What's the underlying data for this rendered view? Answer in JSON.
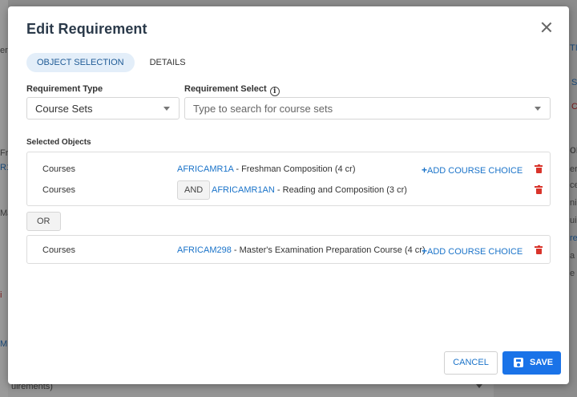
{
  "background": {
    "fragments": [
      "er",
      "Fr",
      "R1",
      "Ma",
      "i",
      "M",
      "TI",
      "S",
      "C",
      "or",
      "er",
      "ce",
      "ni",
      "ui",
      "re",
      "a",
      "e"
    ],
    "bottom_text": "uirements)"
  },
  "modal": {
    "title": "Edit Requirement",
    "tabs": [
      {
        "label": "OBJECT SELECTION",
        "active": true
      },
      {
        "label": "DETAILS",
        "active": false
      }
    ],
    "requirement_type": {
      "label": "Requirement Type",
      "value": "Course Sets"
    },
    "requirement_select": {
      "label": "Requirement Select",
      "placeholder": "Type to search for course sets"
    },
    "selected_objects_label": "Selected Objects",
    "groups": [
      {
        "rows": [
          {
            "type": "Courses",
            "connector": "",
            "code": "AFRICAMR1A",
            "title": " - Freshman Composition (4 cr)",
            "add_choice": "ADD COURSE CHOICE"
          },
          {
            "type": "Courses",
            "connector": "AND",
            "code": "AFRICAMR1AN",
            "title": " - Reading and Composition (3 cr)",
            "add_choice": ""
          }
        ]
      },
      {
        "rows": [
          {
            "type": "Courses",
            "connector": "",
            "code": "AFRICAM298",
            "title": " - Master's Examination Preparation Course (4 cr)",
            "add_choice": "ADD COURSE CHOICE"
          }
        ]
      }
    ],
    "or_label": "OR",
    "buttons": {
      "cancel": "CANCEL",
      "save": "SAVE"
    },
    "colors": {
      "primary": "#1a73e8",
      "link": "#1a73c9",
      "danger": "#d9342b",
      "tab_active_bg": "#e3eef9"
    }
  }
}
